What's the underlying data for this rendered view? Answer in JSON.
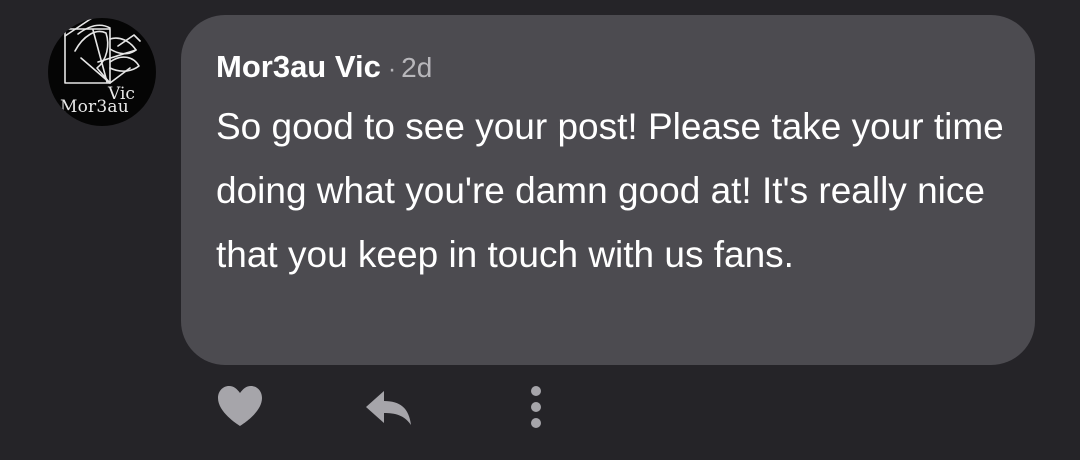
{
  "avatar": {
    "lines": [
      "Vic",
      "Mor3au"
    ]
  },
  "comment": {
    "author": "Mor3au Vic",
    "separator": "·",
    "time": "2d",
    "text": "So good to see your post! Please take your time doing what you're damn good at! It's really nice that you keep in touch with us fans."
  },
  "actions": {
    "icons": [
      "heart-icon",
      "reply-icon",
      "more-vertical-icon"
    ]
  },
  "colors": {
    "background": "#252428",
    "bubble": "#4c4b50",
    "icon": "#a6a5aa",
    "text": "#ffffff",
    "muted_text": "#b8b7bb"
  }
}
